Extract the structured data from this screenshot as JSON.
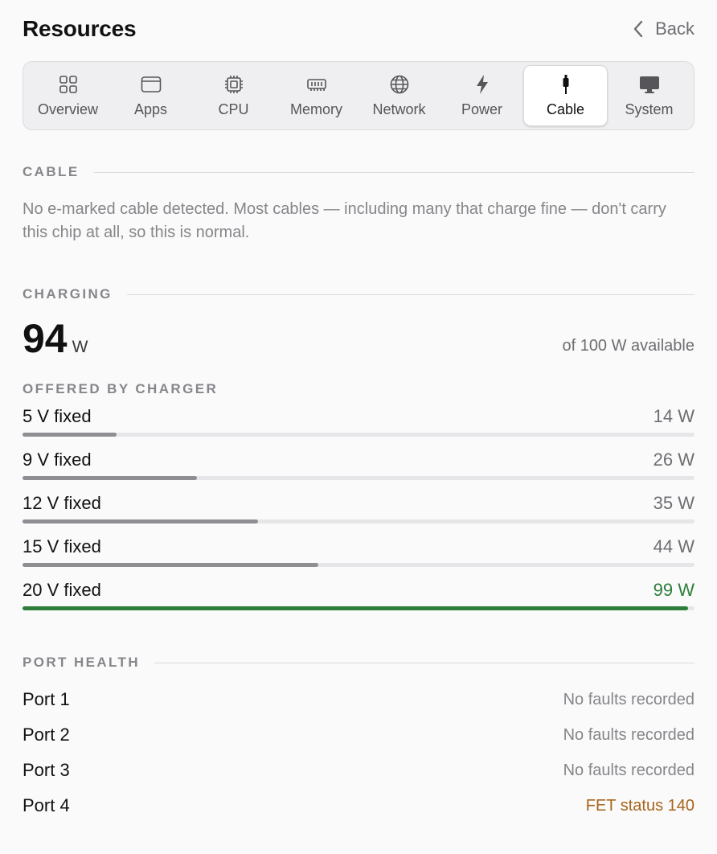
{
  "header": {
    "title": "Resources",
    "back_label": "Back"
  },
  "tabs": [
    {
      "label": "Overview",
      "icon": "grid-icon",
      "active": false
    },
    {
      "label": "Apps",
      "icon": "window-icon",
      "active": false
    },
    {
      "label": "CPU",
      "icon": "cpu-icon",
      "active": false
    },
    {
      "label": "Memory",
      "icon": "memory-icon",
      "active": false
    },
    {
      "label": "Network",
      "icon": "globe-icon",
      "active": false
    },
    {
      "label": "Power",
      "icon": "bolt-icon",
      "active": false
    },
    {
      "label": "Cable",
      "icon": "cable-icon",
      "active": true
    },
    {
      "label": "System",
      "icon": "display-icon",
      "active": false
    }
  ],
  "cable": {
    "section_label": "CABLE",
    "message": "No e-marked cable detected. Most cables — including many that charge fine — don't carry this chip at all, so this is normal."
  },
  "charging": {
    "section_label": "CHARGING",
    "watts": "94",
    "unit": "W",
    "available": "of 100 W available",
    "offered_label": "OFFERED BY CHARGER",
    "max_watts": 100,
    "pdos": [
      {
        "name": "5 V fixed",
        "watts_label": "14 W",
        "watts": 14,
        "best": false
      },
      {
        "name": "9 V fixed",
        "watts_label": "26 W",
        "watts": 26,
        "best": false
      },
      {
        "name": "12 V fixed",
        "watts_label": "35 W",
        "watts": 35,
        "best": false
      },
      {
        "name": "15 V fixed",
        "watts_label": "44 W",
        "watts": 44,
        "best": false
      },
      {
        "name": "20 V fixed",
        "watts_label": "99 W",
        "watts": 99,
        "best": true
      }
    ]
  },
  "port_health": {
    "section_label": "PORT HEALTH",
    "ports": [
      {
        "name": "Port 1",
        "status": "No faults recorded",
        "warn": false
      },
      {
        "name": "Port 2",
        "status": "No faults recorded",
        "warn": false
      },
      {
        "name": "Port 3",
        "status": "No faults recorded",
        "warn": false
      },
      {
        "name": "Port 4",
        "status": "FET status 140",
        "warn": true
      }
    ]
  },
  "colors": {
    "accent_green": "#2e7d3a",
    "warn_orange": "#a8641d",
    "bar_gray": "#8e8e93"
  }
}
